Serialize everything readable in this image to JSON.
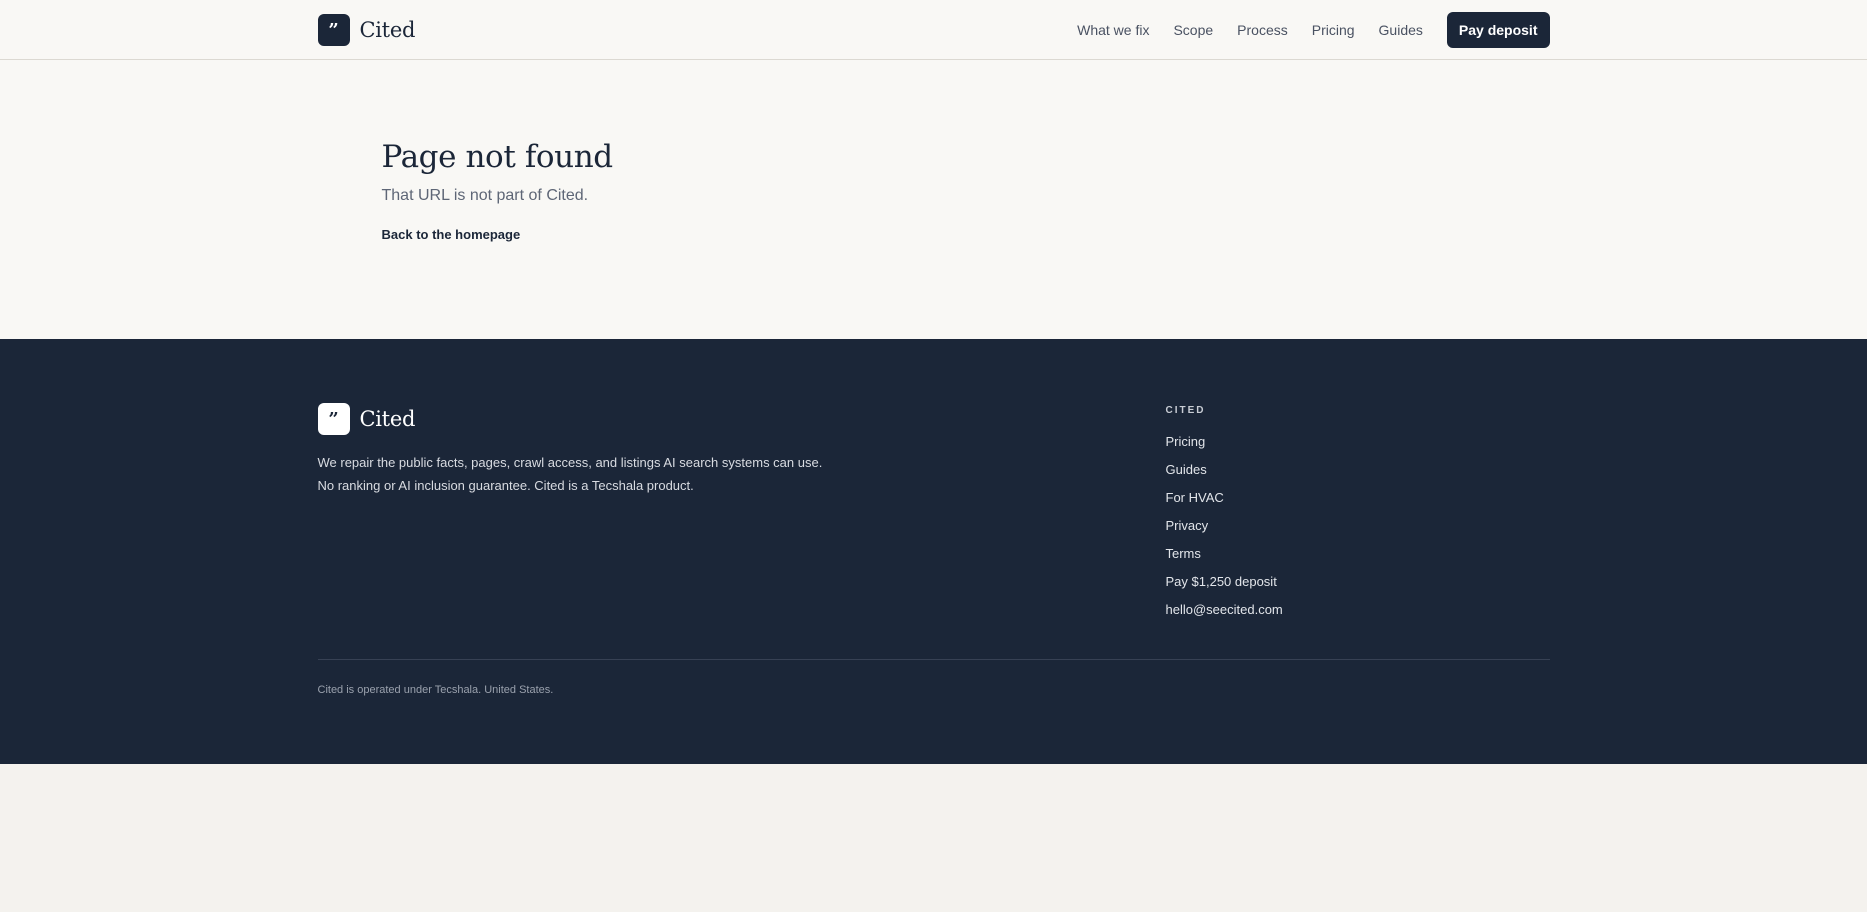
{
  "header": {
    "logo_glyph": "”",
    "brand_name": "Cited",
    "nav": [
      {
        "label": "What we fix"
      },
      {
        "label": "Scope"
      },
      {
        "label": "Process"
      },
      {
        "label": "Pricing"
      },
      {
        "label": "Guides"
      }
    ],
    "cta_label": "Pay deposit"
  },
  "main": {
    "title": "Page not found",
    "subtitle": "That URL is not part of Cited.",
    "back_link": "Back to the homepage"
  },
  "footer": {
    "logo_glyph": "”",
    "brand_name": "Cited",
    "description_line1": "We repair the public facts, pages, crawl access, and listings AI search systems can use.",
    "description_line2": "No ranking or AI inclusion guarantee. Cited is a Tecshala product.",
    "column_heading": "CITED",
    "links": [
      {
        "label": "Pricing"
      },
      {
        "label": "Guides"
      },
      {
        "label": "For HVAC"
      },
      {
        "label": "Privacy"
      },
      {
        "label": "Terms"
      },
      {
        "label": "Pay $1,250 deposit"
      },
      {
        "label": "hello@seecited.com"
      }
    ],
    "legal": "Cited is operated under Tecshala. United States."
  },
  "colors": {
    "navy": "#1b2638",
    "page_background": "#f9f8f5",
    "footer_text": "#d8dbe1"
  },
  "icons": {
    "logo": "quote-mark-icon"
  }
}
